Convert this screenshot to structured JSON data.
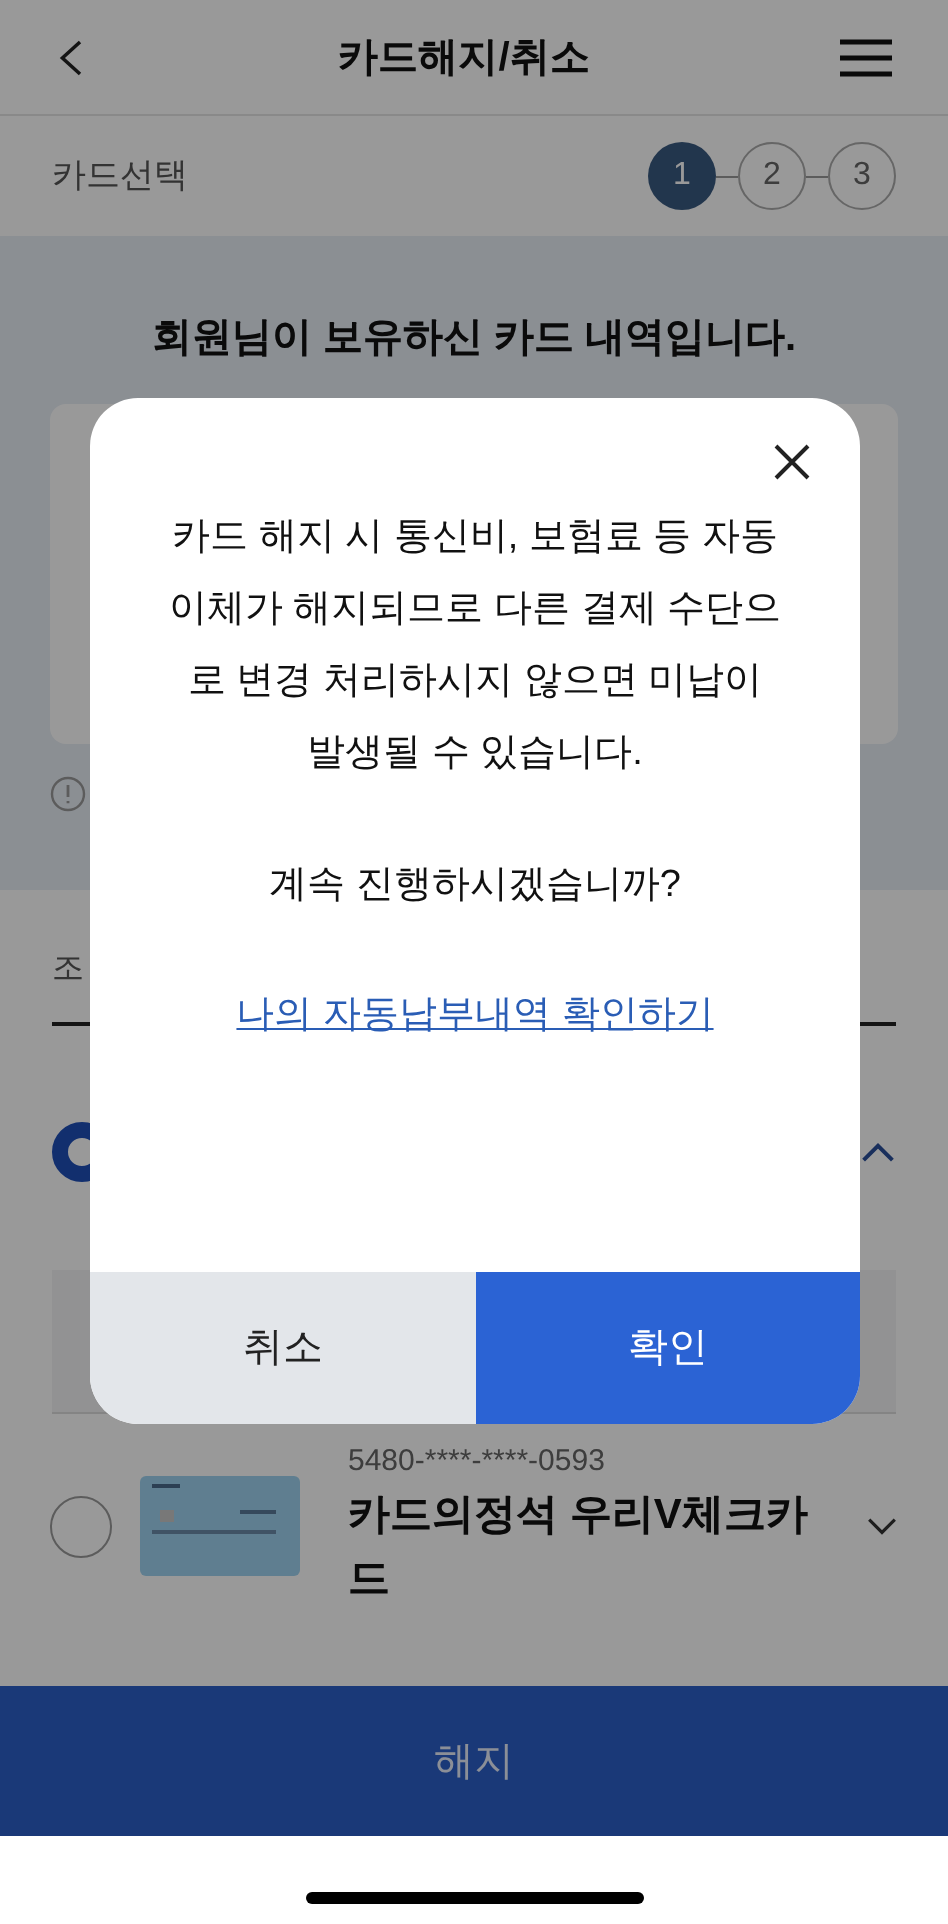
{
  "header": {
    "title": "카드해지/취소"
  },
  "steps": {
    "label": "카드선택",
    "items": [
      {
        "label": "1",
        "selected": true
      },
      {
        "label": "2",
        "selected": false
      },
      {
        "label": "3",
        "selected": false
      }
    ]
  },
  "intro": {
    "title": "회원님이 보유하신 카드 내역입니다."
  },
  "section_label": "조",
  "group": {
    "selected": true,
    "expanded": true
  },
  "cards": [
    {
      "number": "5480-****-****-0593",
      "name": "카드의정석 우리V체크카드",
      "selected": false,
      "expanded": false
    }
  ],
  "bottom_button": {
    "label": "해지"
  },
  "dialog": {
    "message": "카드 해지 시 통신비, 보험료 등 자동이체가 해지되므로 다른 결제 수단으로 변경 처리하시지 않으면 미납이 발생될 수 있습니다.",
    "question": "계속 진행하시겠습니까?",
    "link": "나의 자동납부내역 확인하기",
    "buttons": [
      {
        "label": "취소",
        "kind": "cancel"
      },
      {
        "label": "확인",
        "kind": "confirm"
      }
    ]
  }
}
